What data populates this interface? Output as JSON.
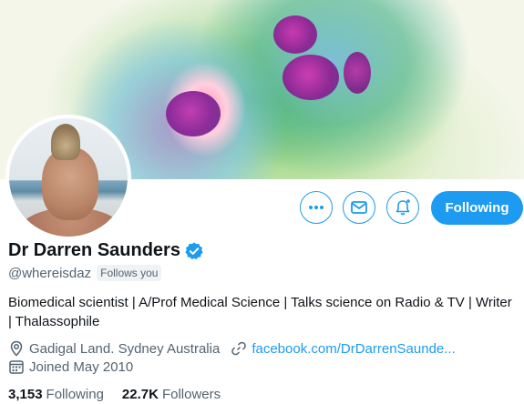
{
  "profile": {
    "name": "Dr Darren Saunders",
    "handle": "@whereisdaz",
    "follows_you": "Follows you",
    "bio": "Biomedical scientist | A/Prof Medical Science | Talks science on Radio & TV | Writer | Thalassophile",
    "location": "Gadigal Land. Sydney Australia",
    "website": "facebook.com/DrDarrenSaunde...",
    "joined": "Joined May 2010",
    "verified_icon": "verified-badge-icon"
  },
  "stats": {
    "following_count": "3,153",
    "following_label": "Following",
    "followers_count": "22.7K",
    "followers_label": "Followers"
  },
  "actions": {
    "following_button": "Following",
    "more_icon": "more-icon",
    "mail_icon": "mail-icon",
    "notify_icon": "notification-bell-plus-icon"
  },
  "colors": {
    "accent": "#1d9bf0",
    "text_primary": "#0f1419",
    "text_secondary": "#536471"
  }
}
